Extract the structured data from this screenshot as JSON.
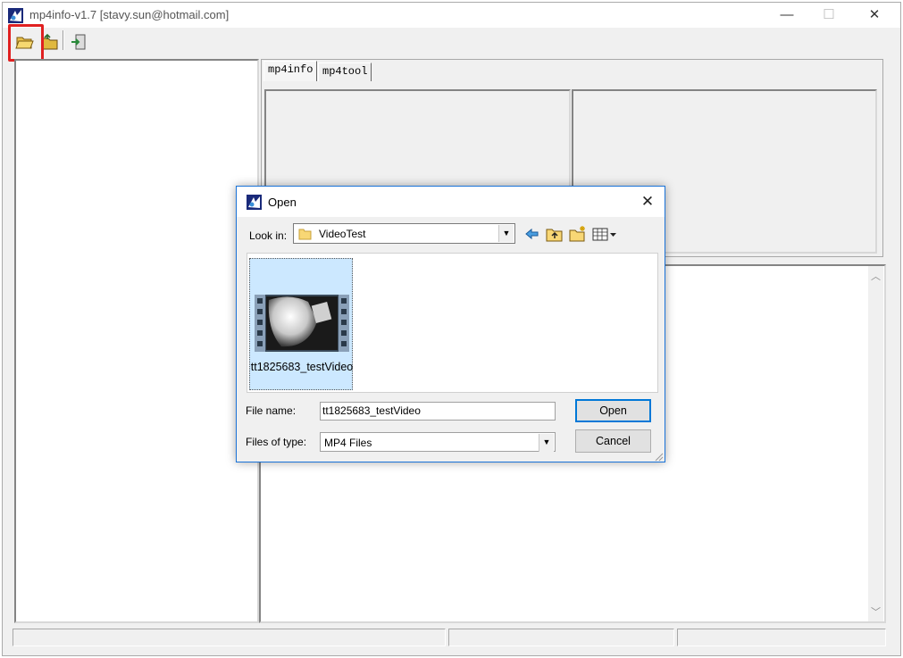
{
  "window": {
    "title": "mp4info-v1.7 [stavy.sun@hotmail.com]",
    "minimize": "—",
    "maximize": "☐",
    "close": "✕"
  },
  "toolbar": {
    "icons": [
      "open-folder-icon",
      "open-folder-alt-icon",
      "exit-icon"
    ]
  },
  "tabs": [
    {
      "label": "mp4info",
      "selected": true
    },
    {
      "label": "mp4tool",
      "selected": false
    }
  ],
  "dialog": {
    "title": "Open",
    "close": "✕",
    "look_in_label": "Look in:",
    "look_in_value": "VideoTest",
    "files": [
      {
        "name": "tt1825683_testVideo",
        "icon": "video-thumbnail-icon",
        "selected": true
      }
    ],
    "file_name_label": "File name:",
    "file_name_value": "tt1825683_testVideo",
    "files_of_type_label": "Files of type:",
    "files_of_type_value": "MP4 Files",
    "open_button": "Open",
    "cancel_button": "Cancel"
  },
  "colors": {
    "highlight": "#e02020",
    "selection": "#cce8ff",
    "accent": "#0078d7"
  }
}
